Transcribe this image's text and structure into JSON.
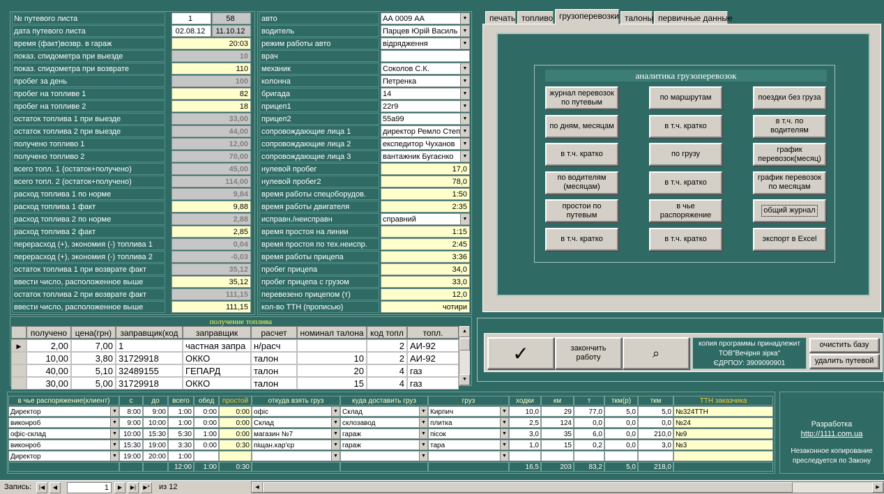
{
  "left_fields": [
    {
      "label": "№ путевого листа",
      "v1": "1",
      "v2": "58"
    },
    {
      "label": "дата путевого листа",
      "v1": "02.08.12",
      "v2": "11.10.12"
    },
    {
      "label": "время (факт)возвр. в гараж",
      "value": "20:03",
      "style": "y"
    },
    {
      "label": "показ. спидометра при выезде",
      "value": "10",
      "style": "g"
    },
    {
      "label": "показ. спидометра при возврате",
      "value": "110",
      "style": "y"
    },
    {
      "label": "пробег за день",
      "value": "100",
      "style": "g"
    },
    {
      "label": "пробег на топливе 1",
      "value": "82",
      "style": "y"
    },
    {
      "label": "пробег на топливе 2",
      "value": "18",
      "style": "y"
    },
    {
      "label": "остаток топлива 1 при выезде",
      "value": "33,00",
      "style": "g"
    },
    {
      "label": "остаток топлива 2 при выезде",
      "value": "44,00",
      "style": "g"
    },
    {
      "label": "получено топливо 1",
      "value": "12,00",
      "style": "g"
    },
    {
      "label": "получено топливо 2",
      "value": "70,00",
      "style": "g"
    },
    {
      "label": "всего топл. 1 (остаток+получено)",
      "value": "45,00",
      "style": "g"
    },
    {
      "label": "всего топл. 2 (остаток+получено)",
      "value": "114,00",
      "style": "g"
    },
    {
      "label": "расход топлива 1 по норме",
      "value": "9,84",
      "style": "g"
    },
    {
      "label": "расход топлива 1 факт",
      "value": "9,88",
      "style": "y"
    },
    {
      "label": "расход топлива 2 по норме",
      "value": "2,88",
      "style": "g"
    },
    {
      "label": "расход топлива 2 факт",
      "value": "2,85",
      "style": "y"
    },
    {
      "label": "перерасход (+), экономия (-) топлива 1",
      "value": "0,04",
      "style": "g"
    },
    {
      "label": "перерасход (+), экономия (-) топлива 2",
      "value": "-0,03",
      "style": "g"
    },
    {
      "label": "остаток топлива 1 при возврате факт",
      "value": "35,12",
      "style": "g"
    },
    {
      "label": "ввести число, расположенное выше",
      "value": "35,12",
      "style": "y"
    },
    {
      "label": "остаток топлива 2 при возврате факт",
      "value": "111,15",
      "style": "g"
    },
    {
      "label": "ввести число, расположенное выше",
      "value": "111,15",
      "style": "y"
    }
  ],
  "right_fields": [
    {
      "label": "авто",
      "value": "АА 0009 АА",
      "dd": true,
      "style": "w"
    },
    {
      "label": "водитель",
      "value": "Парцев Юрій Василь",
      "dd": true,
      "style": "w"
    },
    {
      "label": "режим работы авто",
      "value": "відрядження",
      "dd": true,
      "style": "w"
    },
    {
      "label": "врач",
      "value": "",
      "dd": false,
      "style": "w"
    },
    {
      "label": "механик",
      "value": "Соколов С.К.",
      "dd": true,
      "style": "w"
    },
    {
      "label": "колонна",
      "value": "Петренка",
      "dd": true,
      "style": "w"
    },
    {
      "label": "бригада",
      "value": "14",
      "dd": true,
      "style": "w"
    },
    {
      "label": "прицеп1",
      "value": "22г9",
      "dd": true,
      "style": "w"
    },
    {
      "label": "прицеп2",
      "value": "55а99",
      "dd": true,
      "style": "w"
    },
    {
      "label": "сопровождающие лица 1",
      "value": "директор Ремло Степ",
      "dd": true,
      "style": "w"
    },
    {
      "label": "сопровождающие лица 2",
      "value": "експедитор Чуханов",
      "dd": true,
      "style": "w"
    },
    {
      "label": "сопровождающие лица 3",
      "value": "вантажник Бугаєнко",
      "dd": true,
      "style": "w"
    },
    {
      "label": "нулевой пробег",
      "value": "17,0",
      "dd": false,
      "style": "y"
    },
    {
      "label": "нулевой пробег2",
      "value": "78,0",
      "dd": false,
      "style": "y"
    },
    {
      "label": "время работы спецоборудов.",
      "value": "1:50",
      "dd": false,
      "style": "y"
    },
    {
      "label": "время работы двигателя",
      "value": "2:35",
      "dd": false,
      "style": "y"
    },
    {
      "label": "исправн./неисправн",
      "value": "справний",
      "dd": true,
      "style": "w"
    },
    {
      "label": "время простоя на линии",
      "value": "1:15",
      "dd": false,
      "style": "y"
    },
    {
      "label": "время простоя по тех.неиспр.",
      "value": "2:45",
      "dd": false,
      "style": "y"
    },
    {
      "label": "время работы прицепа",
      "value": "3:36",
      "dd": false,
      "style": "y"
    },
    {
      "label": "пробег прицепа",
      "value": "34,0",
      "dd": false,
      "style": "y"
    },
    {
      "label": "пробег прицепа с грузом",
      "value": "33,0",
      "dd": false,
      "style": "y"
    },
    {
      "label": "перевезено прицепом (т)",
      "value": "12,0",
      "dd": false,
      "style": "y"
    },
    {
      "label": "кол-во ТТН (прописью)",
      "value": "чотири",
      "dd": false,
      "style": "y"
    }
  ],
  "tabs": [
    "печать",
    "топливо",
    "грузоперевозки",
    "талоны",
    "первичные данные"
  ],
  "active_tab": 2,
  "analytics": {
    "title": "аналитика грузоперевозок",
    "buttons": [
      [
        "журнал перевозок по путевым",
        "по маршрутам",
        "поездки без груза"
      ],
      [
        "по дням, месяцам",
        "в т.ч. кратко",
        "в т.ч. по водителям"
      ],
      [
        "в т.ч. кратко",
        "по грузу",
        "график перевозок(месяц)"
      ],
      [
        "по водителям (месяцам)",
        "в т.ч. кратко",
        "график перевозок по месяцам"
      ],
      [
        "простои по путевым",
        "в чье распоряжение",
        "общий журнал"
      ],
      [
        "в т.ч. кратко",
        "в т.ч. кратко",
        "экспорт в Excel"
      ]
    ]
  },
  "fuel": {
    "title": "получение топлива",
    "headers": [
      "получено",
      "цена(грн)",
      "заправщик(код",
      "заправщик",
      "расчет",
      "номинал талона",
      "код топл",
      "топл."
    ],
    "rows": [
      [
        "2,00",
        "7,00",
        "1",
        "частная запра",
        "н/расч",
        "",
        "2",
        "АИ-92"
      ],
      [
        "10,00",
        "3,80",
        "31729918",
        "ОККО",
        "талон",
        "10",
        "2",
        "АИ-92"
      ],
      [
        "40,00",
        "5,10",
        "32489155",
        "ГЕПАРД",
        "талон",
        "20",
        "4",
        "газ"
      ],
      [
        "30,00",
        "5,00",
        "31729918",
        "ОККО",
        "талон",
        "15",
        "4",
        "газ"
      ]
    ]
  },
  "actions": {
    "ok_symbol": "✓",
    "finish_label": "закончить работу",
    "search_symbol": "⌕",
    "copyright_lines": [
      "копия программы принадлежит",
      "ТОВ\"Вечірня зірка\"",
      "ЄДРПОУ: 3909090901"
    ],
    "clear_db": "очистить базу",
    "delete_waybill": "удалить путевой"
  },
  "trips": {
    "headers": [
      "в чье распоряжение(клиент)",
      "с",
      "до",
      "всего",
      "обед",
      "простой",
      "откуда взять груз",
      "куда доставить груз",
      "груз",
      "ходки",
      "км",
      "т",
      "ткм(р)",
      "ткм",
      "ТТН заказчика"
    ],
    "rows": [
      [
        "Директор",
        "8:00",
        "9:00",
        "1:00",
        "0:00",
        "0:00",
        "офіс",
        "Склад",
        "Кирпич",
        "10,0",
        "29",
        "77,0",
        "5,0",
        "5,0",
        "№324ТТН"
      ],
      [
        "виконроб",
        "9:00",
        "10:00",
        "1:00",
        "0:00",
        "0:00",
        "Склад",
        "склозавод",
        "плитка",
        "2,5",
        "124",
        "0,0",
        "0,0",
        "0,0",
        "№24"
      ],
      [
        "офіс-склад",
        "10:00",
        "15:30",
        "5:30",
        "1:00",
        "0:00",
        "магазин №7",
        "гараж",
        "пісок",
        "3,0",
        "35",
        "6,0",
        "0,0",
        "210,0",
        "№9"
      ],
      [
        "виконроб",
        "15:30",
        "19:00",
        "3:30",
        "0:00",
        "0:30",
        "піщан.кар'єр",
        "гараж",
        "тара",
        "1,0",
        "15",
        "0,2",
        "0,0",
        "3,0",
        "№3"
      ],
      [
        "Директор",
        "19:00",
        "20:00",
        "1:00",
        "",
        "",
        "",
        "",
        "",
        "",
        "",
        "",
        "",
        "",
        ""
      ]
    ],
    "totals": [
      "12:00",
      "1:00",
      "0:30",
      "16,5",
      "203",
      "83,2",
      "5,0",
      "218,0"
    ]
  },
  "dev": {
    "label": "Разработка",
    "link": "http://1111.com.ua",
    "notice": "Незаконное копирование преследуется по Закону"
  },
  "record_nav": {
    "label": "Запись:",
    "current": "1",
    "of_label": "из",
    "total": "12"
  }
}
